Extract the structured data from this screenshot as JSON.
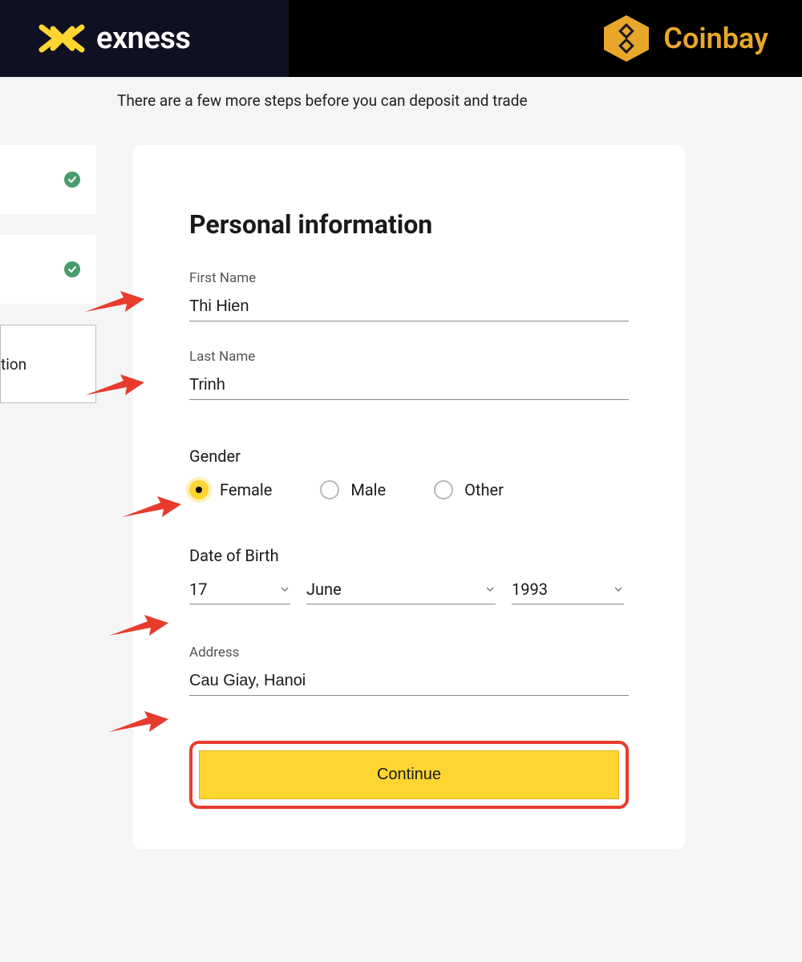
{
  "header": {
    "brand_left": "exness",
    "brand_right": "Coinbay"
  },
  "subtitle": "There are a few more steps before you can deposit and trade",
  "steps": {
    "current_label": "tion"
  },
  "form": {
    "title": "Personal information",
    "first_name_label": "First Name",
    "first_name_value": "Thi Hien",
    "last_name_label": "Last Name",
    "last_name_value": "Trinh",
    "gender_label": "Gender",
    "gender_options": {
      "female": "Female",
      "male": "Male",
      "other": "Other"
    },
    "gender_selected": "female",
    "dob_label": "Date of Birth",
    "dob_day": "17",
    "dob_month": "June",
    "dob_year": "1993",
    "address_label": "Address",
    "address_value": "Cau Giay, Hanoi",
    "continue_label": "Continue"
  },
  "colors": {
    "accent_yellow": "#ffd531",
    "brand_gold": "#e8a72a",
    "check_green": "#4a9c6d",
    "annotation_red": "#e83b2e"
  }
}
